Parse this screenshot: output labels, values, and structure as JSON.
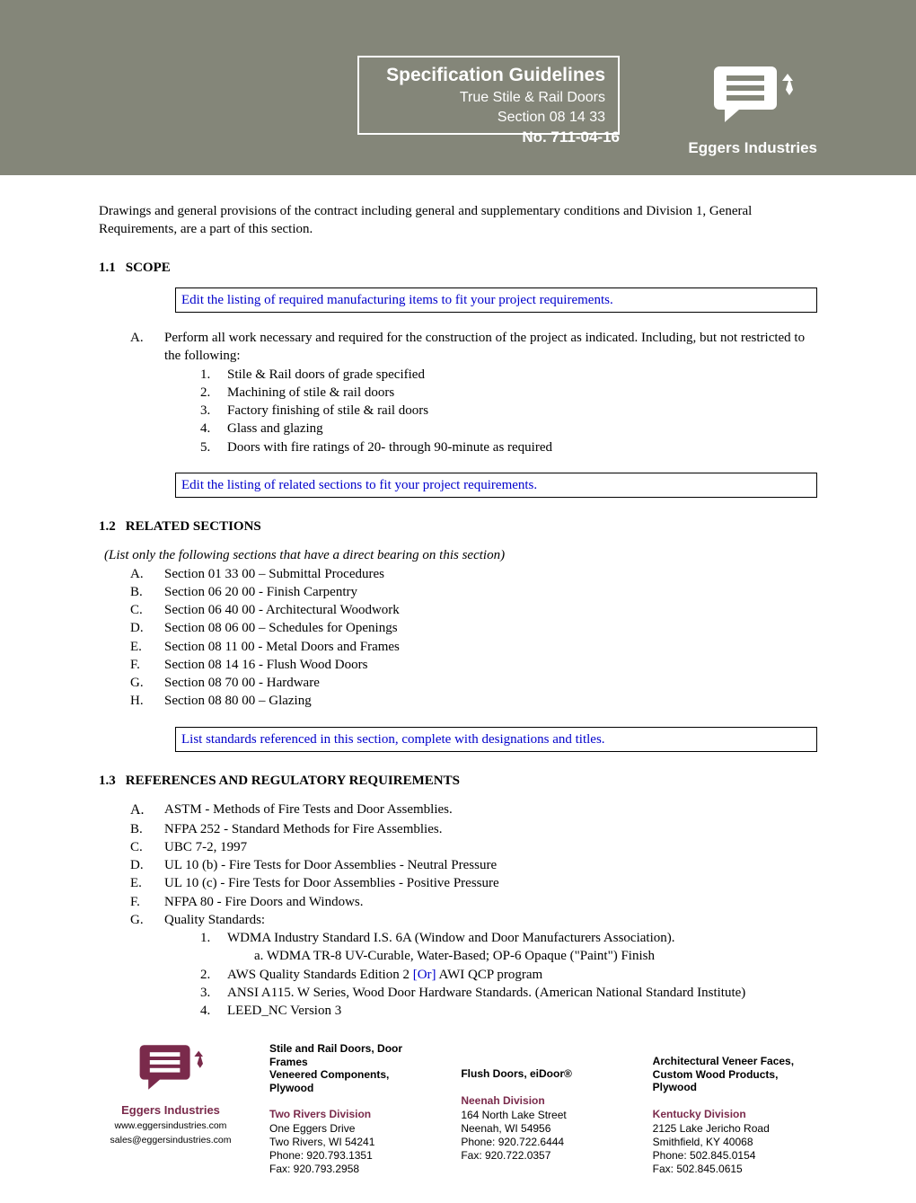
{
  "header": {
    "title": "Specification Guidelines",
    "subtitle": "True Stile & Rail Doors",
    "section": "Section 08 14 33",
    "doc_no": "No. 711-04-16",
    "brand": "Eggers Industries"
  },
  "intro": "Drawings and general provisions of the contract including general and supplementary conditions and Division 1, General Requirements, are a part of this section.",
  "s11": {
    "num": "1.1",
    "title": "SCOPE",
    "note": "Edit the listing of required manufacturing items to fit your project requirements.",
    "A_label": "A.",
    "A_text": "Perform all work necessary and required for the construction of the project as indicated.  Including, but not restricted to the following:",
    "items": [
      {
        "n": "1.",
        "t": "Stile & Rail doors of grade specified"
      },
      {
        "n": "2.",
        "t": "Machining of stile & rail doors"
      },
      {
        "n": "3.",
        "t": "Factory finishing of stile & rail doors"
      },
      {
        "n": "4.",
        "t": "Glass and glazing"
      },
      {
        "n": "5.",
        "t": "Doors with fire ratings of 20- through 90-minute as required"
      }
    ],
    "note2": "Edit the listing of related sections to fit your project requirements."
  },
  "s12": {
    "num": "1.2",
    "title": "RELATED SECTIONS",
    "italic": "(List only the following sections that have a direct bearing on this section)",
    "items": [
      {
        "l": "A.",
        "t": "Section 01 33 00 – Submittal Procedures"
      },
      {
        "l": "B.",
        "t": "Section 06 20 00 - Finish Carpentry"
      },
      {
        "l": "C.",
        "t": "Section 06 40 00 - Architectural Woodwork"
      },
      {
        "l": "D.",
        "t": "Section 08 06 00 – Schedules for Openings"
      },
      {
        "l": "E.",
        "t": "Section 08 11 00 - Metal Doors and Frames"
      },
      {
        "l": "F.",
        "t": "Section 08 14 16 - Flush Wood Doors"
      },
      {
        "l": "G.",
        "t": "Section 08 70 00 - Hardware"
      },
      {
        "l": "H.",
        "t": "Section 08 80 00 – Glazing"
      }
    ],
    "note": "List standards referenced in this section, complete with designations and titles."
  },
  "s13": {
    "num": "1.3",
    "title": "REFERENCES AND REGULATORY REQUIREMENTS",
    "items": [
      {
        "l": "A.",
        "t": "ASTM - Methods of Fire Tests and Door Assemblies."
      },
      {
        "l": "B.",
        "t": "NFPA 252 - Standard Methods for Fire Assemblies."
      },
      {
        "l": "C.",
        "t": "UBC 7-2, 1997"
      },
      {
        "l": "D.",
        "t": "UL 10 (b) - Fire Tests for Door Assemblies - Neutral Pressure"
      },
      {
        "l": "E.",
        "t": "UL 10 (c) - Fire Tests for Door Assemblies - Positive Pressure"
      },
      {
        "l": "F.",
        "t": "NFPA 80 - Fire Doors and Windows."
      },
      {
        "l": "G.",
        "t": "Quality Standards:"
      }
    ],
    "g1": {
      "n": "1.",
      "t": "WDMA Industry Standard I.S. 6A (Window and Door Manufacturers Association)."
    },
    "g1a": "a. WDMA TR-8 UV-Curable, Water-Based;  OP-6 Opaque (\"Paint\") Finish",
    "g2_n": "2.",
    "g2_pre": "AWS Quality Standards Edition 2 ",
    "g2_or": "[Or]",
    "g2_post": " AWI QCP program",
    "g3": {
      "n": "3.",
      "t": "ANSI A115. W Series, Wood Door Hardware Standards.  (American National Standard Institute)"
    },
    "g4": {
      "n": "4.",
      "t": "LEED_NC Version 3"
    }
  },
  "footer": {
    "brand": "Eggers Industries",
    "www": "www.eggersindustries.com",
    "email": "sales@eggersindustries.com",
    "col1": {
      "head1": "Stile and Rail Doors, Door Frames",
      "head2": "Veneered Components, Plywood",
      "div": "Two Rivers Division",
      "addr": [
        "One Eggers Drive",
        "Two Rivers, WI 54241",
        "Phone: 920.793.1351",
        "Fax: 920.793.2958"
      ]
    },
    "col2": {
      "head1": "Flush Doors, eiDoor®",
      "div": "Neenah Division",
      "addr": [
        "164 North Lake Street",
        "Neenah, WI 54956",
        "Phone: 920.722.6444",
        "Fax: 920.722.0357"
      ]
    },
    "col3": {
      "head1": "Architectural Veneer Faces,",
      "head2": "Custom Wood Products, Plywood",
      "div": "Kentucky Division",
      "addr": [
        "2125 Lake Jericho Road",
        "Smithfield, KY 40068",
        "Phone: 502.845.0154",
        "Fax: 502.845.0615"
      ]
    }
  }
}
